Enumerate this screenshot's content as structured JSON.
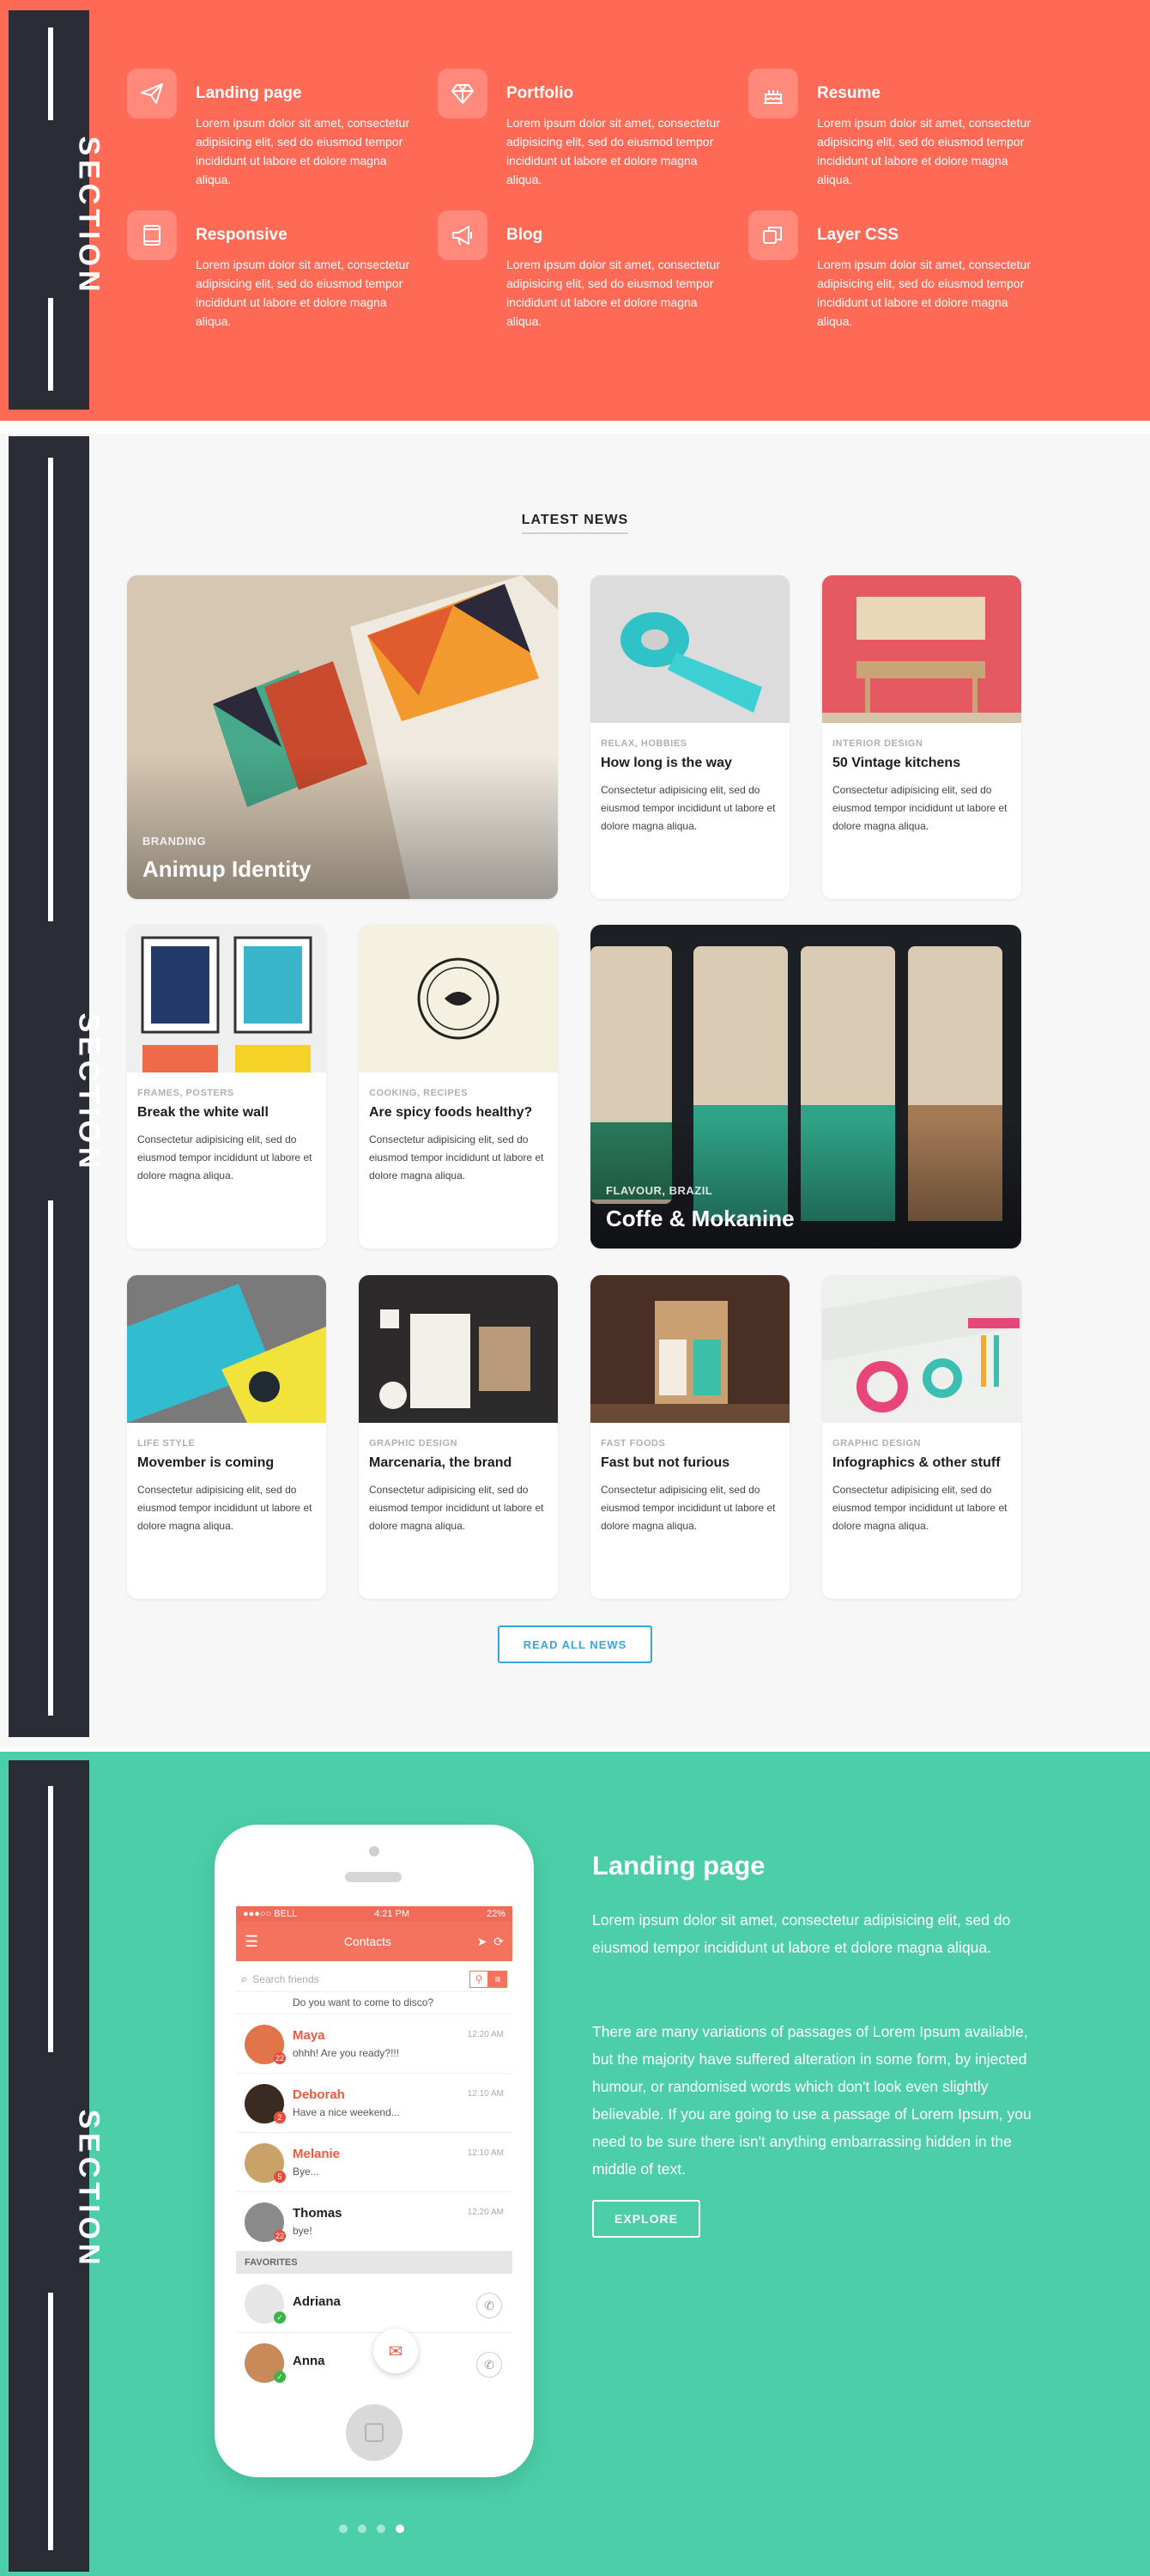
{
  "rail_label": "SECTION",
  "features": [
    {
      "title": "Landing page",
      "desc": "Lorem ipsum dolor sit amet, consectetur adipisicing elit, sed do eiusmod tempor incididunt ut labore et dolore magna aliqua.",
      "icon": "paper-plane-icon"
    },
    {
      "title": "Portfolio",
      "desc": "Lorem ipsum dolor sit amet, consectetur adipisicing elit, sed do eiusmod tempor incididunt ut labore et dolore magna aliqua.",
      "icon": "diamond-icon"
    },
    {
      "title": "Resume",
      "desc": "Lorem ipsum dolor sit amet, consectetur adipisicing elit, sed do eiusmod tempor incididunt ut labore et dolore magna aliqua.",
      "icon": "cake-icon"
    },
    {
      "title": "Responsive",
      "desc": "Lorem ipsum dolor sit amet, consectetur adipisicing elit, sed do eiusmod tempor incididunt ut labore et dolore magna aliqua.",
      "icon": "tablet-icon"
    },
    {
      "title": "Blog",
      "desc": "Lorem ipsum dolor sit amet, consectetur adipisicing elit, sed do eiusmod tempor incididunt ut labore et dolore magna aliqua.",
      "icon": "megaphone-icon"
    },
    {
      "title": "Layer CSS",
      "desc": "Lorem ipsum dolor sit amet, consectetur adipisicing elit, sed do eiusmod tempor incididunt ut labore et dolore magna aliqua.",
      "icon": "layers-icon"
    }
  ],
  "news": {
    "heading": "LATEST NEWS",
    "featured": [
      {
        "category": "BRANDING",
        "title": "Animup Identity"
      },
      {
        "category": "FLAVOUR, BRAZIL",
        "title": "Coffe & Mokanine"
      }
    ],
    "cards": [
      {
        "category": "RELAX, HOBBIES",
        "title": "How long is the way",
        "desc": "Consectetur adipisicing elit, sed do eiusmod tempor incididunt ut labore et dolore magna aliqua."
      },
      {
        "category": "INTERIOR DESIGN",
        "title": "50 Vintage kitchens",
        "desc": "Consectetur adipisicing elit, sed do eiusmod tempor incididunt ut labore et dolore magna aliqua."
      },
      {
        "category": "FRAMES, POSTERS",
        "title": "Break the white wall",
        "desc": "Consectetur adipisicing elit, sed do eiusmod tempor incididunt ut labore et dolore magna aliqua."
      },
      {
        "category": "COOKING, RECIPES",
        "title": "Are spicy foods healthy?",
        "desc": "Consectetur adipisicing elit, sed do eiusmod tempor incididunt ut labore et dolore magna aliqua."
      },
      {
        "category": "LIFE STYLE",
        "title": "Movember is coming",
        "desc": "Consectetur adipisicing elit, sed do eiusmod tempor incididunt ut labore et dolore magna aliqua."
      },
      {
        "category": "GRAPHIC DESIGN",
        "title": "Marcenaria, the brand",
        "desc": "Consectetur adipisicing elit, sed do eiusmod tempor incididunt ut labore et dolore magna aliqua."
      },
      {
        "category": "FAST FOODS",
        "title": "Fast but not furious",
        "desc": "Consectetur adipisicing elit, sed do eiusmod tempor incididunt ut labore et dolore magna aliqua."
      },
      {
        "category": "GRAPHIC DESIGN",
        "title": "Infographics & other stuff",
        "desc": "Consectetur adipisicing elit, sed do eiusmod tempor incididunt ut labore et dolore magna aliqua."
      }
    ],
    "read_all": "READ ALL NEWS"
  },
  "phone": {
    "carrier": "●●●○○ BELL",
    "time": "4:21 PM",
    "battery": "22%",
    "nav_title": "Contacts",
    "search_placeholder": "Search friends",
    "partial_msg": "Do you want to come to disco?",
    "contacts": [
      {
        "name": "Maya",
        "msg": "ohhh! Are you ready?!!!",
        "time": "12:20 AM",
        "badge": "22"
      },
      {
        "name": "Deborah",
        "msg": "Have a nice weekend...",
        "time": "12:10 AM",
        "badge": "2"
      },
      {
        "name": "Melanie",
        "msg": "Bye...",
        "time": "12:10 AM",
        "badge": "5"
      },
      {
        "name": "Thomas",
        "msg": "bye!",
        "time": "12:20 AM",
        "badge": "22"
      }
    ],
    "favorites_label": "FAVORITES",
    "favorites": [
      {
        "name": "Adriana"
      },
      {
        "name": "Anna"
      }
    ]
  },
  "landing": {
    "title": "Landing page",
    "p1": "Lorem ipsum dolor sit amet, consectetur adipisicing elit, sed do eiusmod tempor incididunt ut labore et dolore magna aliqua.",
    "p2": "There are many variations of passages of Lorem Ipsum available, but the majority have suffered alteration in some form, by injected humour, or randomised words which don't look even slightly believable. If you are going to use a passage of Lorem Ipsum, you need to be sure there isn't anything embarrassing hidden in the middle of text.",
    "button": "EXPLORE"
  },
  "colors": {
    "coral": "#ff6a57",
    "teal": "#4ccfa9",
    "rail": "#2b2d36",
    "link": "#3aa6d8"
  }
}
